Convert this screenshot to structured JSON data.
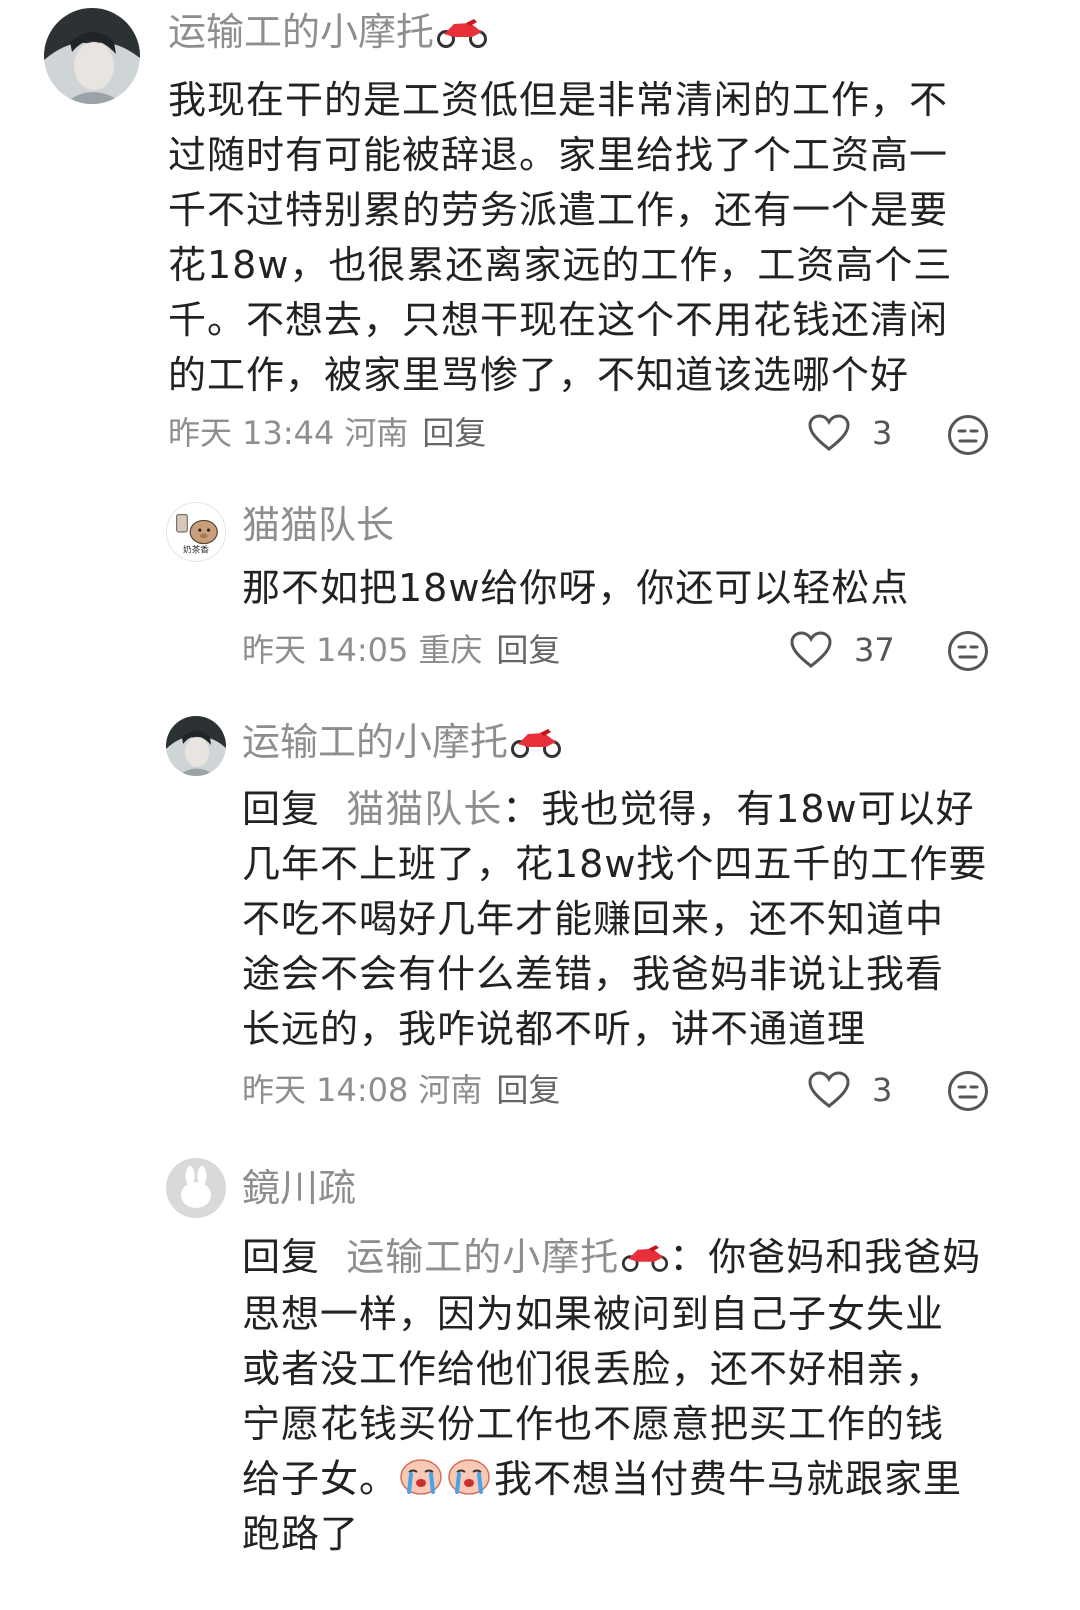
{
  "comments": [
    {
      "username": "运输工的小摩托",
      "lines": [
        "我现在干的是工资低但是非常清闲的工作，不",
        "过随时有可能被辞退。家里给找了个工资高一",
        "千不过特别累的劳务派遣工作，还有一个是要",
        "花18w，也很累还离家远的工作，工资高个三",
        "千。不想去，只想干现在这个不用花钱还清闲",
        "的工作，被家里骂惨了，不知道该选哪个好"
      ],
      "time": "昨天 13:44",
      "location": "河南",
      "reply_label": "回复",
      "likes": "3"
    },
    {
      "username": "猫猫队长",
      "avatar_text": "奶茶香",
      "lines": [
        "那不如把18w给你呀，你还可以轻松点"
      ],
      "time": "昨天 14:05",
      "location": "重庆",
      "reply_label": "回复",
      "likes": "37"
    },
    {
      "username": "运输工的小摩托",
      "reply_prefix": "回复",
      "reply_target": "猫猫队长",
      "first_line_rest": "：我也觉得，有18w可以好",
      "lines": [
        "几年不上班了，花18w找个四五千的工作要",
        "不吃不喝好几年才能赚回来，还不知道中",
        "途会不会有什么差错，我爸妈非说让我看",
        "长远的，我咋说都不听，讲不通道理"
      ],
      "time": "昨天 14:08",
      "location": "河南",
      "reply_label": "回复",
      "likes": "3"
    },
    {
      "username": "鏡川疏",
      "reply_prefix": "回复",
      "reply_target": "运输工的小摩托",
      "first_line_rest": "：你爸妈和我爸妈",
      "lines": [
        "思想一样，因为如果被问到自己子女失业",
        "或者没工作给他们很丢脸，还不好相亲，",
        "宁愿花钱买份工作也不愿意把买工作的钱"
      ],
      "line_with_emoji": "给子女。",
      "line_after_emoji": "我不想当付费牛马就跟家里",
      "last_line": "跑路了"
    }
  ],
  "icons": {
    "like": "heart-outline-icon",
    "dislike": "unhappy-face-icon",
    "badge": "motorcycle-icon",
    "emoji": "crying-face-emoji"
  },
  "colors": {
    "username": "#8e8e8e",
    "text": "#222222",
    "meta": "#8e8e8e",
    "moto": "#e8303a"
  }
}
